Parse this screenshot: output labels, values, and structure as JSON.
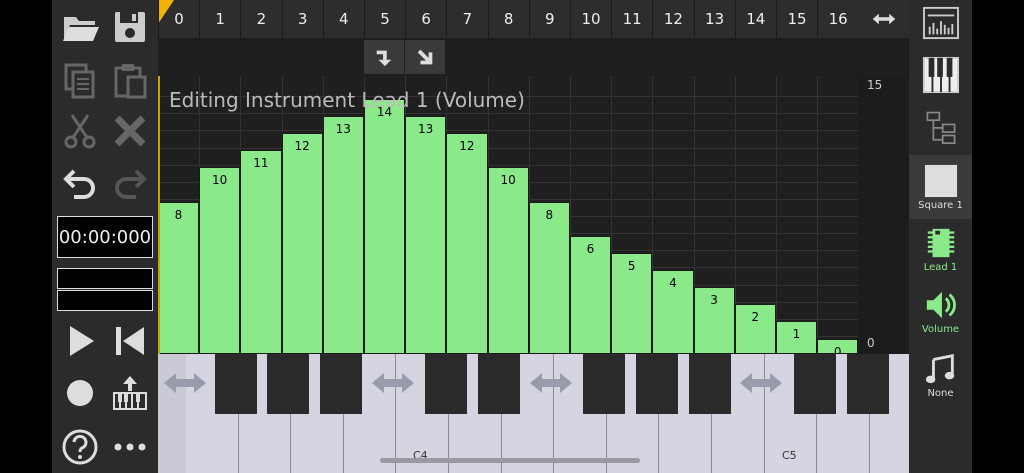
{
  "toolbar": {
    "time_display": "00:00:000"
  },
  "header": {
    "columns": [
      "0",
      "1",
      "2",
      "3",
      "4",
      "5",
      "6",
      "7",
      "8",
      "9",
      "10",
      "11",
      "12",
      "13",
      "14",
      "15",
      "16"
    ]
  },
  "editor": {
    "title": "Editing Instrument Lead 1 (Volume)",
    "values": [
      8,
      10,
      11,
      12,
      13,
      14,
      13,
      12,
      10,
      8,
      6,
      5,
      4,
      3,
      2,
      1,
      0
    ],
    "max_value": 15,
    "scale_top": "15",
    "scale_bottom": "0"
  },
  "piano": {
    "c4_label": "C4",
    "c5_label": "C5"
  },
  "right_toolbar": {
    "square_label": "Square 1",
    "lead_label": "Lead 1",
    "volume_label": "Volume",
    "none_label": "None"
  },
  "colors": {
    "bar": "#8aea8a",
    "accent": "#8aea8a",
    "loop_marker": "#f0b400"
  }
}
